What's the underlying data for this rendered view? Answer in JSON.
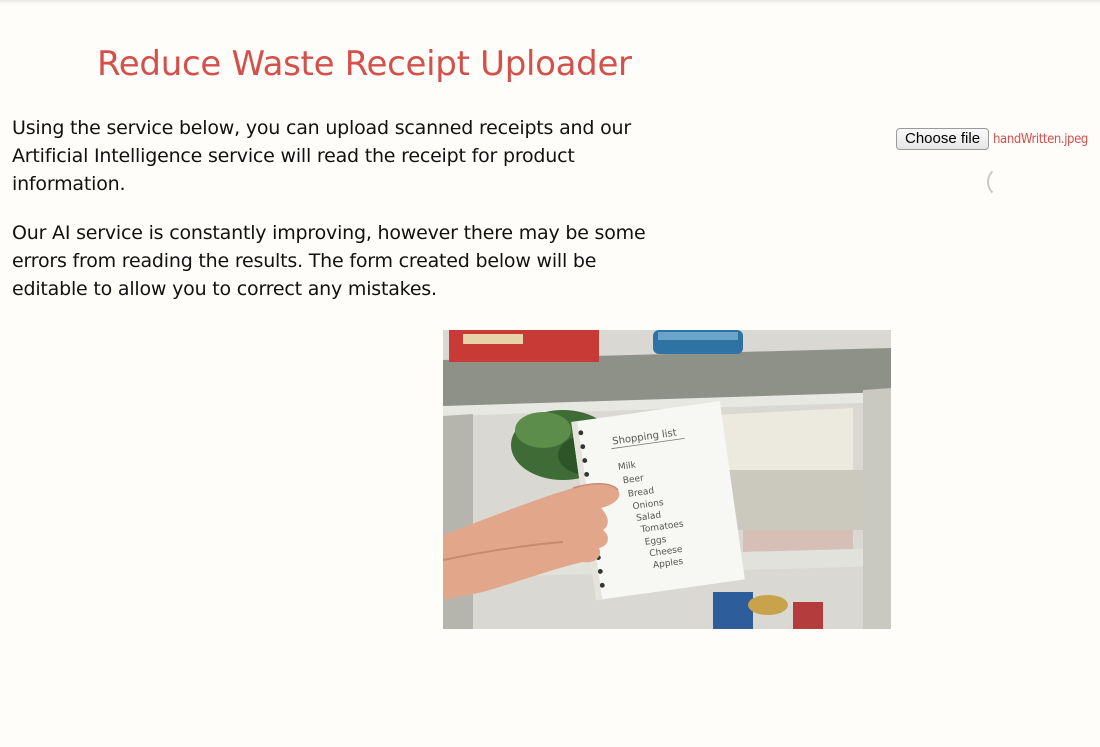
{
  "page": {
    "title": "Reduce Waste Receipt Uploader",
    "intro_paragraphs": [
      "Using the service below, you can upload scanned receipts and our Artificial Intelligence service will read the receipt for product information.",
      "Our AI service is constantly improving, however there may be some errors from reading the results. The form created below will be editable to allow you to correct any mistakes."
    ]
  },
  "upload": {
    "button_label": "Choose file",
    "selected_file": "handWritten.jpeg",
    "status": "loading"
  },
  "preview": {
    "list_heading": "Shopping list",
    "list_items": [
      "Milk",
      "Beer",
      "Bread",
      "Onions",
      "Salad",
      "Tomatoes",
      "Eggs",
      "Cheese",
      "Apples"
    ]
  },
  "colors": {
    "accent": "#d4504b",
    "background": "#fefdf9",
    "text": "#111111"
  }
}
